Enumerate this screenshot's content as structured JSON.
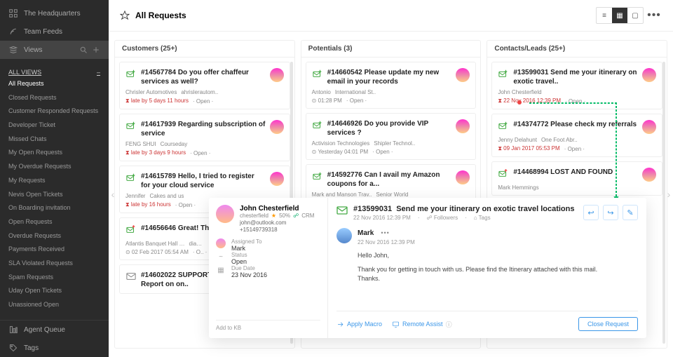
{
  "sidebar": {
    "top": [
      {
        "label": "The Headquarters",
        "icon": "hq"
      },
      {
        "label": "Team Feeds",
        "icon": "feed"
      }
    ],
    "views_label": "Views",
    "all_views": "ALL VIEWS",
    "items": [
      "All Requests",
      "Closed Requests",
      "Customer Responded Requests",
      "Developer Ticket",
      "Missed Chats",
      "My Open Requests",
      "My Overdue Requests",
      "My Requests",
      "Nevis Open Tickets",
      "On Boarding invitation",
      "Open Requests",
      "Overdue Requests",
      "Payments Received",
      "SLA Violated Requests",
      "Spam Requests",
      "Uday Open Tickets",
      "Unassioned Open"
    ],
    "bottom": [
      {
        "label": "Agent Queue",
        "icon": "queue"
      },
      {
        "label": "Tags",
        "icon": "tag"
      }
    ]
  },
  "header": {
    "title": "All Requests"
  },
  "columns": [
    {
      "title": "Customers (25+)",
      "cards": [
        {
          "kind": "mail-down",
          "id": "#14567784",
          "subject": "Do you offer chaffeur services as well?",
          "from": "Chrisler Automotives",
          "org": "ahrislerautom..",
          "late": "late by 5 days 11 hours",
          "status": "Open"
        },
        {
          "kind": "mail-down",
          "id": "#14617939",
          "subject": "Regarding subscription of service",
          "from": "FENG SHUI",
          "org": "Courseday",
          "late": "late by 3 days 9 hours",
          "status": "Open"
        },
        {
          "kind": "mail-down",
          "id": "#14615789",
          "subject": "Hello, I tried to register for your cloud service",
          "from": "Jennifer",
          "org": "Cakes and us",
          "late": "late by 16 hours",
          "status": "Open"
        },
        {
          "kind": "mail-up",
          "id": "#14656646",
          "subject": "Great! Thank! your help",
          "from": "Atlantis Banquet Hall …",
          "org": "dia…",
          "time": "02 Feb 2017 05:54 AM",
          "status": "O.."
        },
        {
          "kind": "mail-plain",
          "id": "#14602022",
          "subject": "SUPPORT REQUEST: Report on on..",
          "from": "",
          "org": "",
          "late": "",
          "status": ""
        }
      ]
    },
    {
      "title": "Potentials (3)",
      "cards": [
        {
          "kind": "mail-down",
          "id": "#14660542",
          "subject": "Please update my new email in your records",
          "from": "Antonio",
          "org": "International St..",
          "time": "01:28 PM",
          "status": "Open"
        },
        {
          "kind": "mail-down",
          "id": "#14646926",
          "subject": "Do you provide VIP services ?",
          "from": "Activision Technologies",
          "org": "Shipler Technol..",
          "time": "Yesterday 04:01 PM",
          "status": "Open"
        },
        {
          "kind": "mail-down",
          "id": "#14592776",
          "subject": "Can I avail my Amazon coupons for a...",
          "from": "Mark and Manson Trav..",
          "org": "Senior World"
        }
      ]
    },
    {
      "title": "Contacts/Leads (25+)",
      "cards": [
        {
          "kind": "mail-down",
          "id": "#13599031",
          "subject": "Send me your itinerary on exotic travel..",
          "from": "John Chesterfield",
          "late": "22 Nov 2016 12:39 PM",
          "status": "Open"
        },
        {
          "kind": "mail-down",
          "id": "#14374772",
          "subject": "Please check my referrals",
          "from": "Jenny Delahunt",
          "org": "One Foot Abr..",
          "late": "09 Jan 2017 05:53 PM",
          "status": "Open"
        },
        {
          "kind": "mail-up",
          "id": "#14468994",
          "subject": "LOST AND FOUND",
          "from": "Mark Hemmings"
        }
      ]
    }
  ],
  "detail": {
    "contact": {
      "name": "John Chesterfield",
      "handle": "chesterfield",
      "score": "50%",
      "source": "CRM",
      "email": "john@outlook.com",
      "phone": "+15149739318"
    },
    "rows": [
      {
        "icon": "user",
        "label": "Assigned To",
        "value": "Mark"
      },
      {
        "icon": "status",
        "label": "Status",
        "value": "Open"
      },
      {
        "icon": "date",
        "label": "Due Date",
        "value": "23 Nov 2016"
      }
    ],
    "addkb": "Add to KB",
    "ticket": {
      "id": "#13599031",
      "subject": "Send me your itinerary on exotic travel locations",
      "time": "22 Nov 2016 12:39 PM",
      "followers": "Followers",
      "tags": "Tags"
    },
    "msg": {
      "from": "Mark",
      "time": "22 Nov 2016 12:39 PM",
      "hello": "Hello John,",
      "body": "Thank you for getting in touch with us. Please find the Itinerary attached with this mail.",
      "thanks": "Thanks."
    },
    "footer": {
      "macro": "Apply Macro",
      "remote": "Remote Assist",
      "close": "Close Request"
    }
  }
}
